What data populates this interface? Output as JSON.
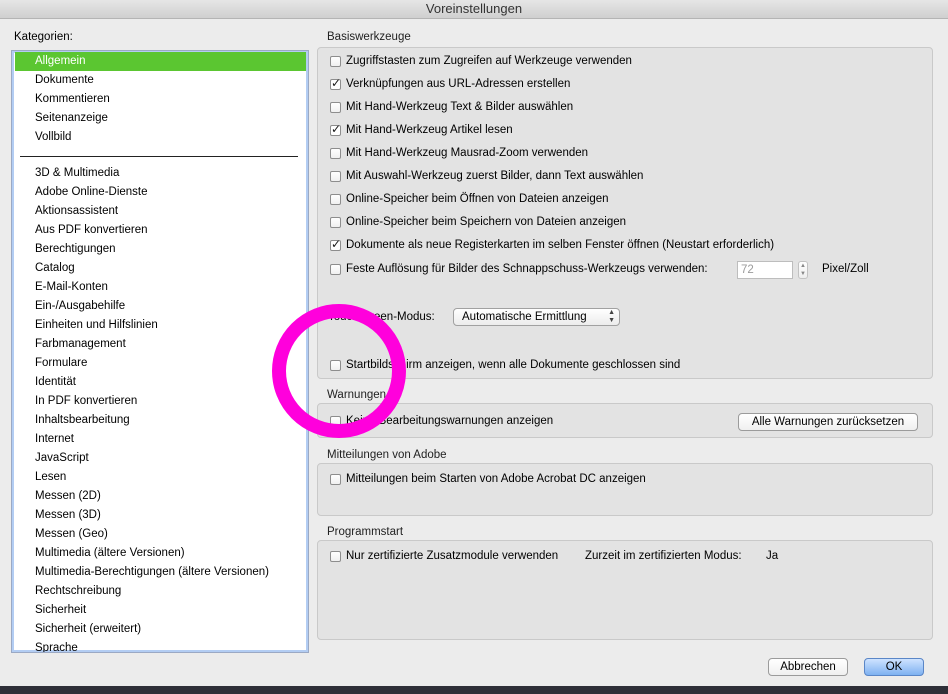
{
  "window": {
    "title": "Voreinstellungen"
  },
  "categories": {
    "label": "Kategorien:",
    "group1": [
      "Allgemein",
      "Dokumente",
      "Kommentieren",
      "Seitenanzeige",
      "Vollbild"
    ],
    "selected": "Allgemein",
    "group2": [
      "3D & Multimedia",
      "Adobe Online-Dienste",
      "Aktionsassistent",
      "Aus PDF konvertieren",
      "Berechtigungen",
      "Catalog",
      "E-Mail-Konten",
      "Ein-/Ausgabehilfe",
      "Einheiten und Hilfslinien",
      "Farbmanagement",
      "Formulare",
      "Identität",
      "In PDF konvertieren",
      "Inhaltsbearbeitung",
      "Internet",
      "JavaScript",
      "Lesen",
      "Messen (2D)",
      "Messen (3D)",
      "Messen (Geo)",
      "Multimedia (ältere Versionen)",
      "Multimedia-Berechtigungen (ältere Versionen)",
      "Rechtschreibung",
      "Sicherheit",
      "Sicherheit (erweitert)",
      "Sprache"
    ]
  },
  "basis": {
    "caption": "Basiswerkzeuge",
    "options": [
      {
        "label": "Zugriffstasten zum Zugreifen auf Werkzeuge verwenden",
        "checked": false
      },
      {
        "label": "Verknüpfungen aus URL-Adressen erstellen",
        "checked": true
      },
      {
        "label": "Mit Hand-Werkzeug Text & Bilder auswählen",
        "checked": false
      },
      {
        "label": "Mit Hand-Werkzeug Artikel lesen",
        "checked": true
      },
      {
        "label": "Mit Hand-Werkzeug Mausrad-Zoom verwenden",
        "checked": false
      },
      {
        "label": "Mit Auswahl-Werkzeug zuerst Bilder, dann Text auswählen",
        "checked": false
      },
      {
        "label": "Online-Speicher beim Öffnen von Dateien anzeigen",
        "checked": false
      },
      {
        "label": "Online-Speicher beim Speichern von Dateien anzeigen",
        "checked": false
      },
      {
        "label": "Dokumente als neue Registerkarten im selben Fenster öffnen (Neustart erforderlich)",
        "checked": true
      }
    ],
    "resolution": {
      "label": "Feste Auflösung für Bilder des Schnappschuss-Werkzeugs verwenden:",
      "checked": false,
      "value": "72",
      "unit": "Pixel/Zoll"
    },
    "touch": {
      "label": "Touchscreen-Modus:",
      "value": "Automatische Ermittlung"
    },
    "startscreen": {
      "label": "Startbildschirm anzeigen, wenn alle Dokumente geschlossen sind",
      "checked": false
    }
  },
  "warnings": {
    "caption": "Warnungen",
    "option": {
      "label": "Keine Bearbeitungswarnungen anzeigen",
      "checked": false
    },
    "reset_button": "Alle Warnungen zurücksetzen"
  },
  "adobe": {
    "caption": "Mitteilungen von Adobe",
    "option": {
      "label": "Mitteilungen beim Starten von Adobe Acrobat DC anzeigen",
      "checked": false
    }
  },
  "startup": {
    "caption": "Programmstart",
    "option": {
      "label": "Nur zertifizierte Zusatzmodule verwenden",
      "checked": false
    },
    "mode_label": "Zurzeit im zertifizierten Modus:",
    "mode_value": "Ja"
  },
  "footer": {
    "cancel": "Abbrechen",
    "ok": "OK"
  },
  "annotation": {
    "ring_color": "#ff00dc"
  }
}
